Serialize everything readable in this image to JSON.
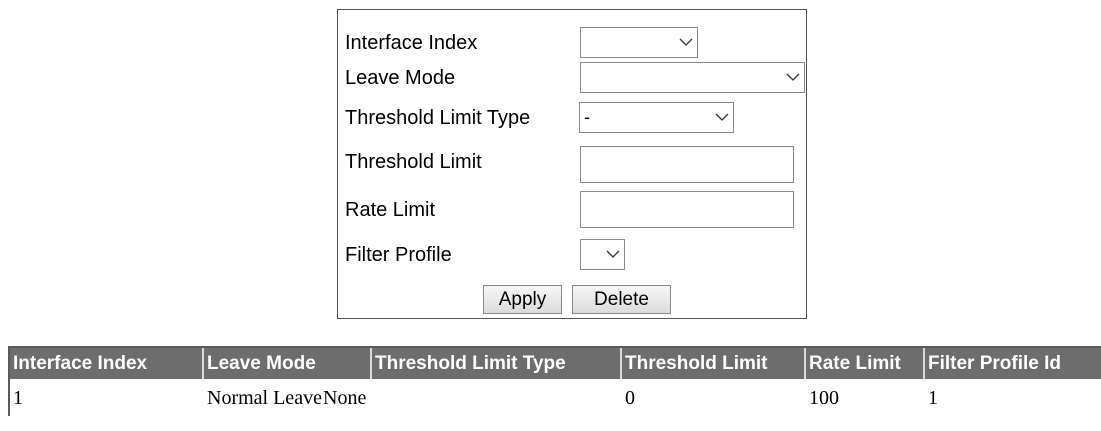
{
  "form": {
    "interface_index": {
      "label": "Interface Index",
      "value": ""
    },
    "leave_mode": {
      "label": "Leave Mode",
      "value": ""
    },
    "threshold_limit_type": {
      "label": "Threshold Limit Type",
      "value": "-"
    },
    "threshold_limit": {
      "label": "Threshold Limit",
      "value": ""
    },
    "rate_limit": {
      "label": "Rate Limit",
      "value": ""
    },
    "filter_profile": {
      "label": "Filter Profile",
      "value": ""
    },
    "apply_label": "Apply",
    "delete_label": "Delete"
  },
  "table": {
    "headers": [
      "Interface Index",
      "Leave Mode",
      "Threshold Limit Type",
      "Threshold Limit",
      "Rate Limit",
      "Filter Profile Id"
    ],
    "rows": [
      [
        "1",
        "Normal Leave",
        "None",
        "0",
        "100",
        "1"
      ]
    ]
  },
  "colors": {
    "header_bg": "#6d6d6d",
    "header_text": "#ffffff"
  },
  "icons": {
    "dropdown": "chevron-down-icon"
  }
}
